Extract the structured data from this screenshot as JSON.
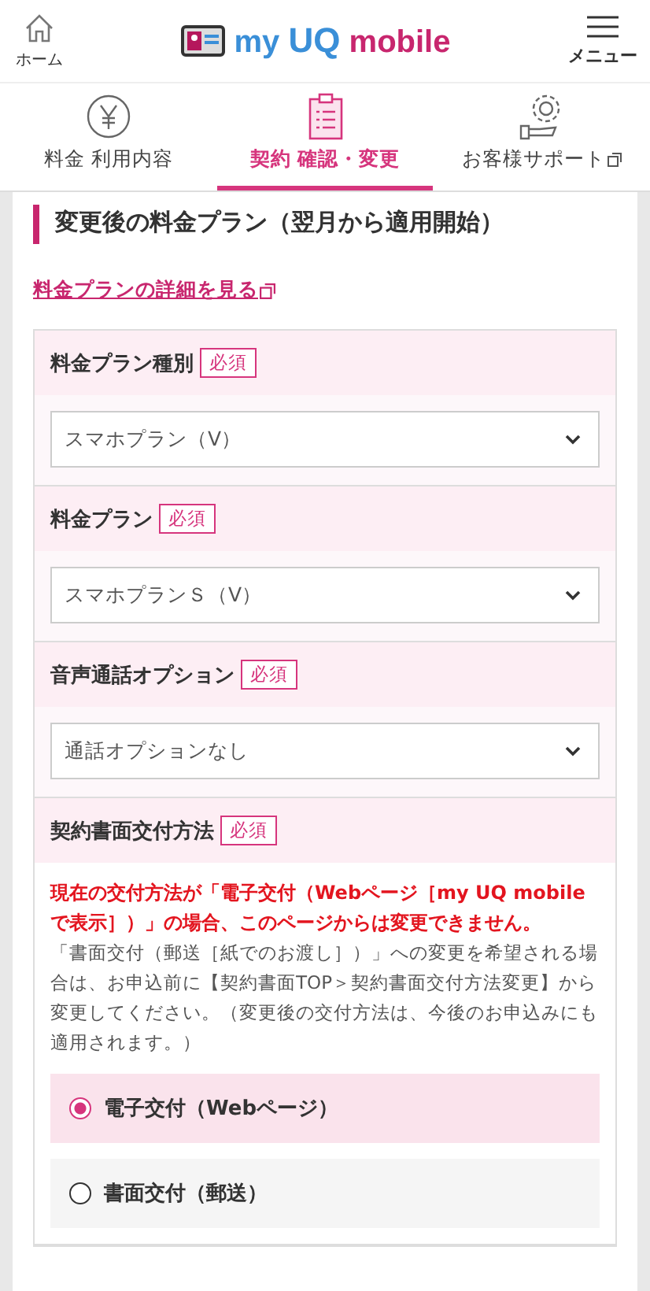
{
  "header": {
    "home_label": "ホーム",
    "logo": [
      "my",
      "UQ",
      "mobile"
    ],
    "menu_label": "メニュー"
  },
  "tabs": [
    {
      "label": "料金 利用内容",
      "selected": false,
      "external": false
    },
    {
      "label": "契約 確認・変更",
      "selected": true,
      "external": false
    },
    {
      "label": "お客様サポート",
      "selected": false,
      "external": true
    }
  ],
  "section_title": "変更後の料金プラン（翌月から適用開始）",
  "detail_link": "料金プランの詳細を見る",
  "fields": [
    {
      "kind": "select",
      "label": "料金プラン種別",
      "required": "必須",
      "value": "スマホプラン（V）"
    },
    {
      "kind": "select",
      "label": "料金プラン",
      "required": "必須",
      "value": "スマホプランＳ（V）"
    },
    {
      "kind": "select",
      "label": "音声通話オプション",
      "required": "必須",
      "value": "通話オプションなし"
    },
    {
      "kind": "radio",
      "label": "契約書面交付方法",
      "required": "必須",
      "warning": "現在の交付方法が「電子交付（Webページ［my UQ mobileで表示］）」の場合、このページからは変更できません。",
      "note": "「書面交付（郵送［紙でのお渡し］）」への変更を希望される場合は、お申込前に【契約書面TOP＞契約書面交付方法変更】から変更してください。（変更後の交付方法は、今後のお申込みにも適用されます。）",
      "options": [
        {
          "label": "電子交付（Webページ）",
          "selected": true
        },
        {
          "label": "書面交付（郵送）",
          "selected": false
        }
      ]
    }
  ]
}
